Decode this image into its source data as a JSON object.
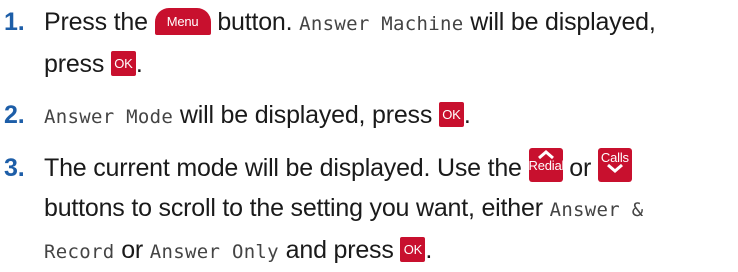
{
  "steps": [
    {
      "number": "1.",
      "t1": "Press the",
      "key_menu": "Menu",
      "t2": "button.",
      "lcd1": "Answer Machine",
      "t3": "will be displayed,",
      "t4": "press",
      "key_ok": "OK",
      "t5": "."
    },
    {
      "number": "2.",
      "lcd1": "Answer Mode",
      "t1": "will be displayed, press",
      "key_ok": "OK",
      "t2": "."
    },
    {
      "number": "3.",
      "t1": "The current mode will be displayed. Use the",
      "key_redial": "Redial",
      "t2": "or",
      "key_calls": "Calls",
      "t3": "buttons to scroll to the setting you want, either",
      "lcd1": "Answer &",
      "lcd2": "Record",
      "t4": "or",
      "lcd3": "Answer Only",
      "t5": "and press",
      "key_ok": "OK",
      "t6": "."
    }
  ],
  "colors": {
    "step_number": "#1d5ea8",
    "key_background": "#c8102e",
    "key_text": "#ffffff"
  },
  "icons": {
    "redial": "chevron-up-icon",
    "calls": "chevron-down-icon"
  }
}
